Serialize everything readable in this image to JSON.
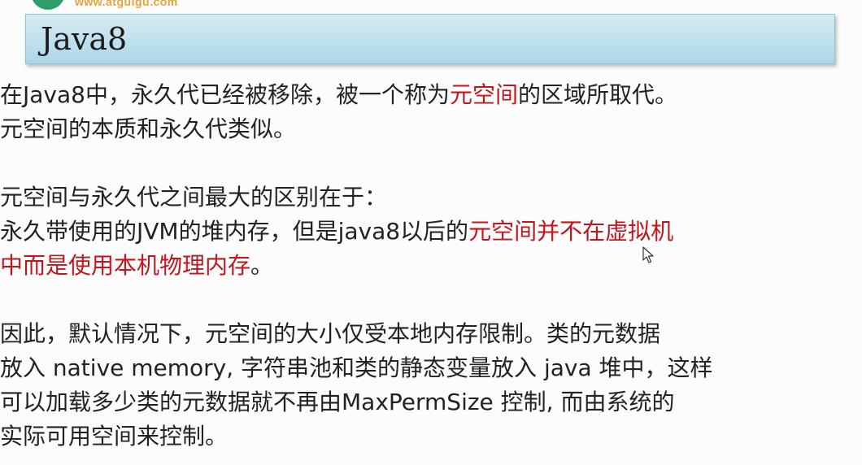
{
  "header": {
    "site_url": "www.atguigu.com",
    "title": "Java8"
  },
  "para1": {
    "line1_pre": "在Java8中，永久代已经被移除，被一个称为",
    "line1_red": "元空间",
    "line1_post": "的区域所取代。",
    "line2": "元空间的本质和永久代类似。"
  },
  "para2": {
    "line1": "元空间与永久代之间最大的区别在于：",
    "line2_pre": "永久带使用的JVM的堆内存，但是java8以后的",
    "line2_red": "元空间并不在虚拟机",
    "line3_red": "中而是使用本机物理内存",
    "line3_post": "。"
  },
  "para3": {
    "line1": "因此，默认情况下，元空间的大小仅受本地内存限制。类的元数据",
    "line2": "放入 native memory, 字符串池和类的静态变量放入 java 堆中，这样",
    "line3": "可以加载多少类的元数据就不再由MaxPermSize 控制, 而由系统的",
    "line4": "实际可用空间来控制。"
  },
  "colors": {
    "emphasis": "#c0161c",
    "title_bar": "#bfe0ee",
    "text": "#222222"
  }
}
